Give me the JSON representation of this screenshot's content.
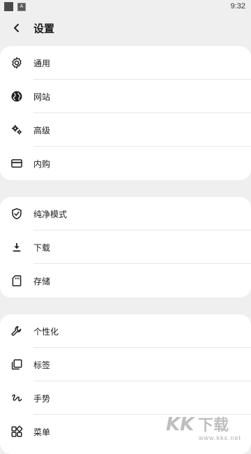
{
  "status_bar": {
    "time": "9:32",
    "badge": "A"
  },
  "header": {
    "title": "设置"
  },
  "groups": [
    {
      "items": [
        {
          "label": "通用",
          "icon": "gear-icon"
        },
        {
          "label": "网站",
          "icon": "globe-icon"
        },
        {
          "label": "高级",
          "icon": "gears-icon"
        },
        {
          "label": "内购",
          "icon": "card-icon"
        }
      ]
    },
    {
      "items": [
        {
          "label": "纯净模式",
          "icon": "shield-check-icon"
        },
        {
          "label": "下载",
          "icon": "download-icon"
        },
        {
          "label": "存储",
          "icon": "sd-card-icon"
        }
      ]
    },
    {
      "items": [
        {
          "label": "个性化",
          "icon": "wrench-icon"
        },
        {
          "label": "标签",
          "icon": "tabs-icon"
        },
        {
          "label": "手势",
          "icon": "gesture-icon"
        },
        {
          "label": "菜单",
          "icon": "menu-grid-icon"
        }
      ]
    }
  ],
  "watermark": {
    "text": "www.kkx.net"
  }
}
